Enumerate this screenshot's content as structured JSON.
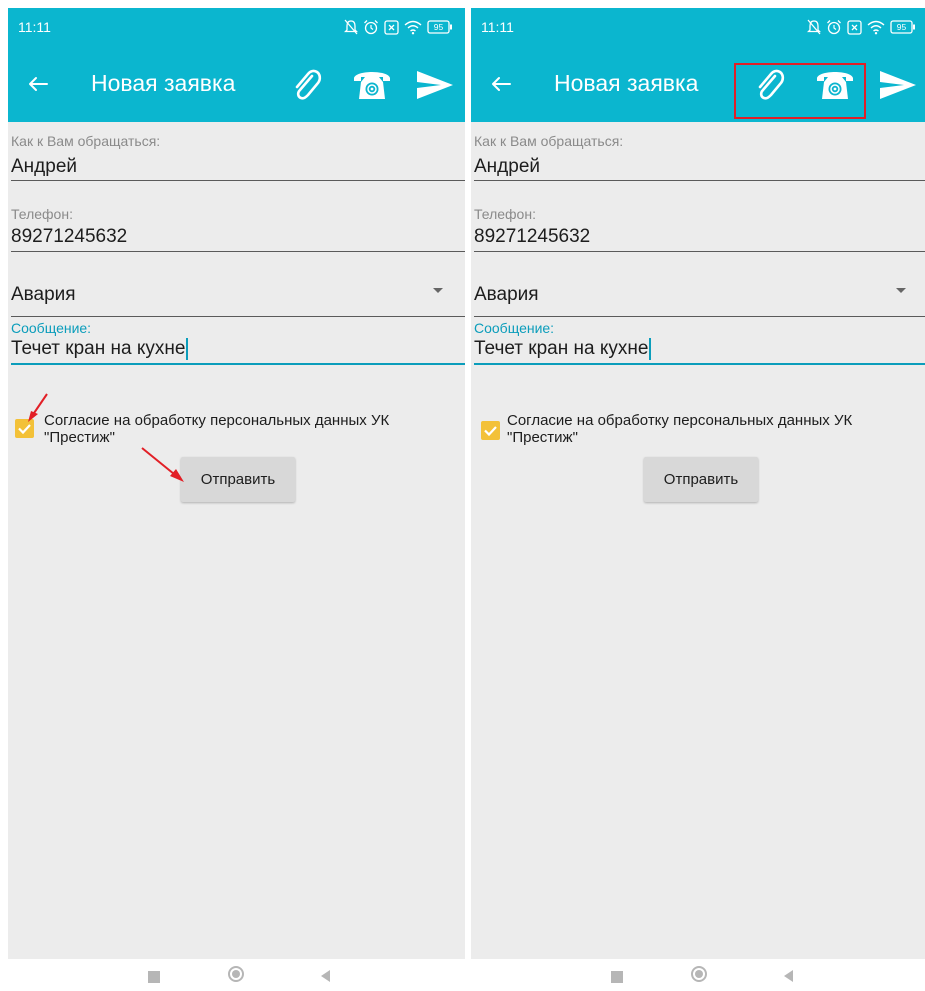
{
  "colors": {
    "accent": "#0bb6cf",
    "focus": "#0b9dbb",
    "checkbox": "#f3c138",
    "highlight": "#e21f26",
    "background": "#ececec"
  },
  "status_bar": {
    "time": "11:11",
    "battery": "95",
    "icons": [
      "mute-icon",
      "alarm-icon",
      "sim-icon",
      "wifi-icon",
      "battery-icon"
    ]
  },
  "toolbar": {
    "title": "Новая заявка",
    "icons": [
      "back-arrow-icon",
      "paperclip-icon",
      "phone-icon",
      "send-icon"
    ]
  },
  "form": {
    "name_label": "Как к Вам обращаться:",
    "name_value": "Андрей",
    "phone_label": "Телефон:",
    "phone_value": "89271245632",
    "category_value": "Авария",
    "message_label": "Сообщение:",
    "message_value": "Течет кран на кухне",
    "consent_checked": true,
    "consent_line1": "Согласие на обработку персональных данных УК",
    "consent_line2": "\"Престиж\"",
    "submit_label": "Отправить"
  },
  "nav_bar": {
    "icons": [
      "recents-square-icon",
      "home-circle-icon",
      "back-triangle-icon"
    ]
  }
}
